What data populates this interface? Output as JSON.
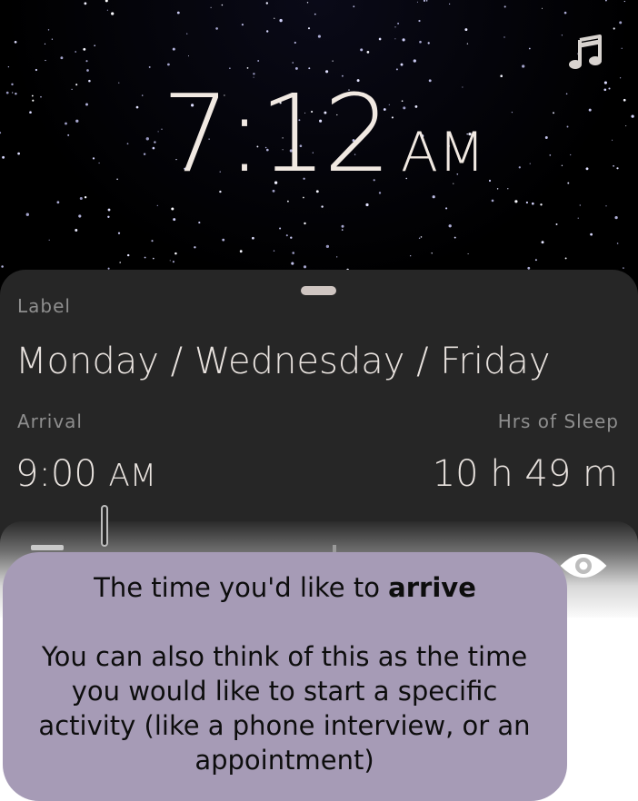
{
  "clock": {
    "time": "7:12",
    "ampm": "AM"
  },
  "icons": {
    "music": "music-note-icon",
    "eye": "eye-icon"
  },
  "sheet": {
    "label_title": "Label",
    "label_value": "Monday / Wednesday / Friday",
    "arrival_title": "Arrival",
    "arrival_time": "9:00",
    "arrival_ampm": "AM",
    "sleep_title": "Hrs of Sleep",
    "sleep_value": "10 h  49 m"
  },
  "tooltip": {
    "prefix": "The time you'd like to ",
    "emphasis": "arrive",
    "body": "You can also think of this as the time you would like to start a specific activity (like a phone interview, or an appointment)"
  },
  "colors": {
    "background": "#000000",
    "sheet": "#262626",
    "tooltip": "#a69bb6",
    "text_light": "#f1e9e2",
    "label_gray": "#8e8e8e"
  }
}
